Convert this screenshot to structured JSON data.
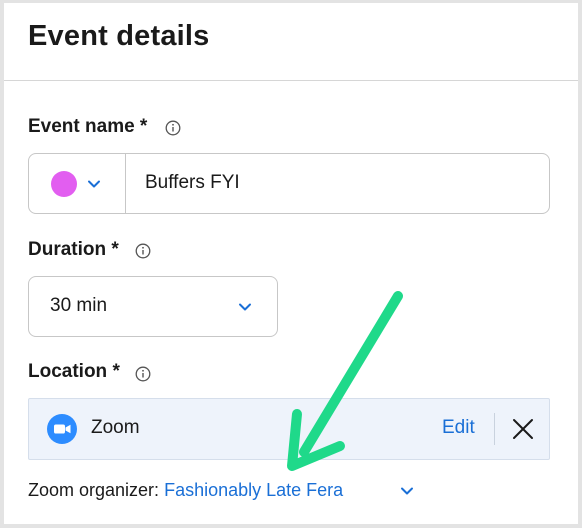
{
  "header": {
    "title": "Event details"
  },
  "event_name": {
    "label": "Event name *",
    "color": "#e25ef0",
    "value": "Buffers FYI"
  },
  "duration": {
    "label": "Duration *",
    "selected": "30 min"
  },
  "location": {
    "label": "Location *",
    "provider": "Zoom",
    "edit_label": "Edit"
  },
  "organizer": {
    "label": "Zoom organizer:",
    "name": "Fashionably Late Fera"
  },
  "colors": {
    "accent": "#1a6fd6",
    "zoom": "#2d8cff",
    "arrow": "#1fd98a"
  }
}
